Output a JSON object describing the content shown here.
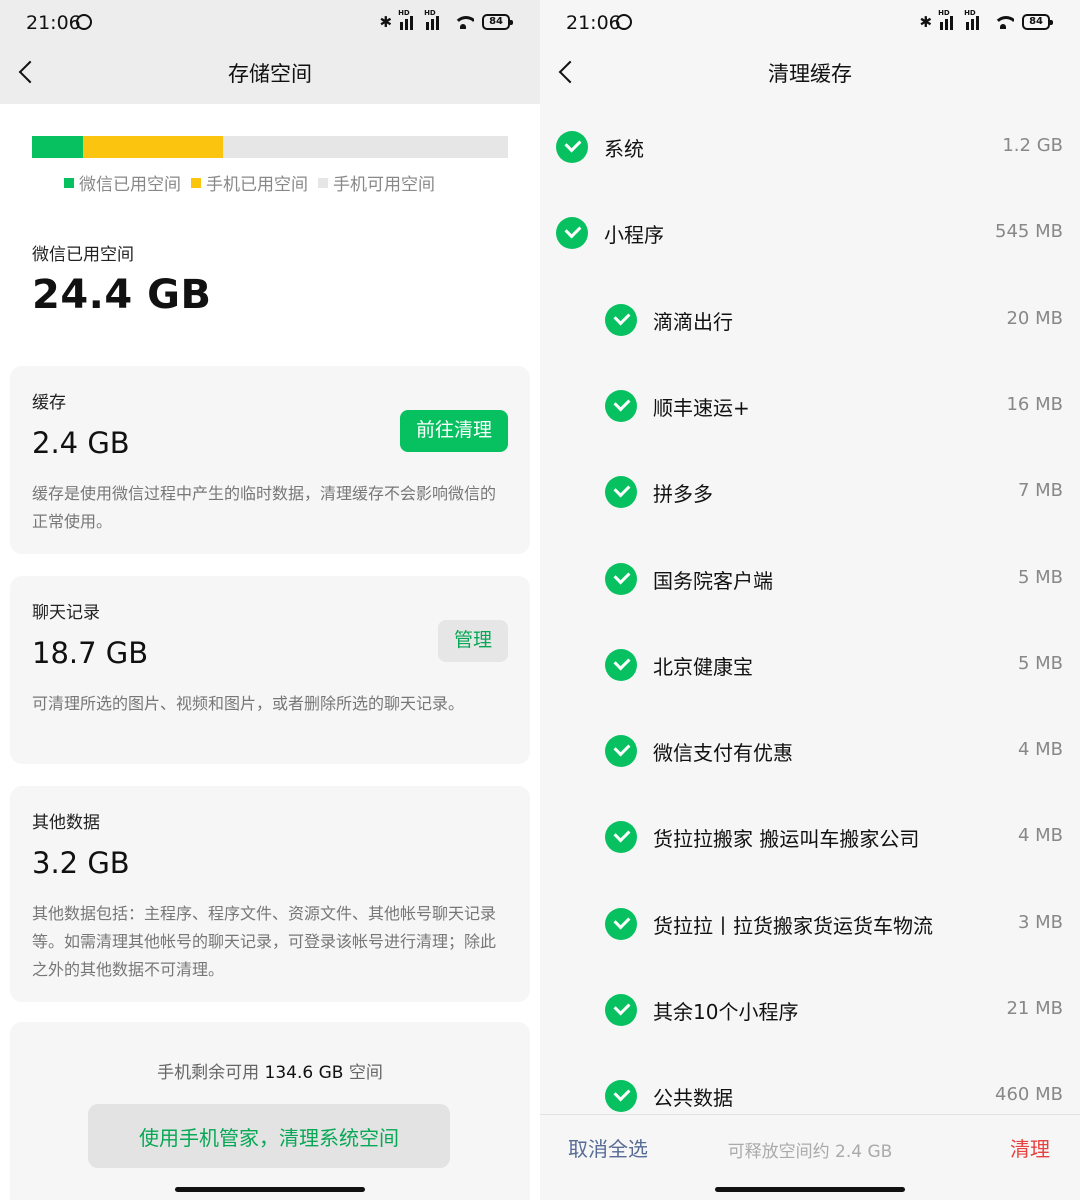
{
  "status_bar": {
    "time": "21:06",
    "battery": "84",
    "hd": "HD"
  },
  "left": {
    "title": "存储空间",
    "usage": {
      "wechat_fraction": 0.107,
      "phone_fraction": 0.294,
      "colors": {
        "wechat": "#07c160",
        "phone": "#fac40f",
        "free": "#e6e6e6"
      }
    },
    "legend": [
      "微信已用空间",
      "手机已用空间",
      "手机可用空间"
    ],
    "used_label": "微信已用空间",
    "used_value": "24.4 GB",
    "cache": {
      "title": "缓存",
      "size": "2.4 GB",
      "button": "前往清理",
      "desc": "缓存是使用微信过程中产生的临时数据，清理缓存不会影响微信的正常使用。"
    },
    "chat": {
      "title": "聊天记录",
      "size": "18.7 GB",
      "button": "管理",
      "desc": "可清理所选的图片、视频和图片，或者删除所选的聊天记录。"
    },
    "other": {
      "title": "其他数据",
      "size": "3.2 GB",
      "desc": "其他数据包括：主程序、程序文件、资源文件、其他帐号聊天记录等。如需清理其他帐号的聊天记录，可登录该帐号进行清理；除此之外的其他数据不可清理。"
    },
    "remaining": {
      "prefix": "手机剩余可用 ",
      "value": "134.6 GB",
      "suffix": " 空间"
    },
    "manager_button": "使用手机管家，清理系统空间"
  },
  "right": {
    "title": "清理缓存",
    "items": [
      {
        "name": "系统",
        "size": "1.2 GB",
        "level": 0
      },
      {
        "name": "小程序",
        "size": "545 MB",
        "level": 0
      },
      {
        "name": "滴滴出行",
        "size": "20 MB",
        "level": 1
      },
      {
        "name": "顺丰速运+",
        "size": "16 MB",
        "level": 1
      },
      {
        "name": "拼多多",
        "size": "7 MB",
        "level": 1
      },
      {
        "name": "国务院客户端",
        "size": "5 MB",
        "level": 1
      },
      {
        "name": "北京健康宝",
        "size": "5 MB",
        "level": 1
      },
      {
        "name": "微信支付有优惠",
        "size": "4 MB",
        "level": 1
      },
      {
        "name": "货拉拉搬家 搬运叫车搬家公司",
        "size": "4 MB",
        "level": 1
      },
      {
        "name": "货拉拉丨拉货搬家货运货车物流",
        "size": "3 MB",
        "level": 1
      },
      {
        "name": "其余10个小程序",
        "size": "21 MB",
        "level": 1
      },
      {
        "name": "公共数据",
        "size": "460 MB",
        "level": 1
      }
    ],
    "footer": {
      "cancel": "取消全选",
      "release": "可释放空间约 2.4 GB",
      "clean": "清理"
    }
  }
}
